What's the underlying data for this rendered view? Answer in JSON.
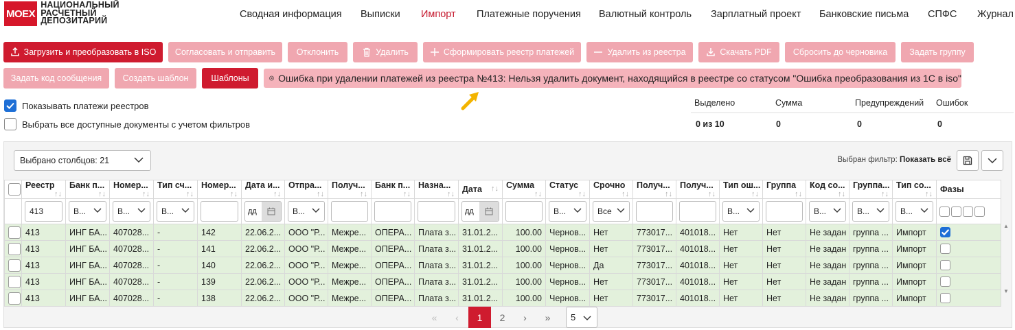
{
  "header": {
    "logo_mark": "MOEX",
    "logo_line1": "НАЦИОНАЛЬНЫЙ",
    "logo_line2": "РАСЧЕТНЫЙ",
    "logo_line3": "ДЕПОЗИТАРИЙ",
    "nav": [
      "Сводная информация",
      "Выписки",
      "Импорт",
      "Платежные поручения",
      "Валютный контроль",
      "Зарплатный проект",
      "Банковские письма",
      "СПФС",
      "Журнал"
    ],
    "active_nav": "Импорт"
  },
  "toolbar": {
    "upload": "Загрузить и преобразовать в ISO",
    "approve": "Согласовать и отправить",
    "reject": "Отклонить",
    "delete": "Удалить",
    "form_registry": "Сформировать реестр платежей",
    "remove_from_registry": "Удалить из реестра",
    "download_pdf": "Скачать PDF",
    "reset_draft": "Сбросить до черновика",
    "set_group": "Задать группу",
    "set_msg_code": "Задать код сообщения",
    "create_template": "Создать шаблон",
    "templates": "Шаблоны"
  },
  "error": "Ошибка при удалении платежей из реестра №413: Нельзя удалить документ, находящийся в реестре со статусом \"Ошибка преобразования из 1С в iso\"",
  "options": {
    "show_registry_payments": "Показывать платежи реестров",
    "select_all": "Выбрать все доступные документы с учетом фильтров"
  },
  "stats": {
    "selected_label": "Выделено",
    "selected": "0 из 10",
    "sum_label": "Сумма",
    "sum": "0",
    "warnings_label": "Предупреждений",
    "warnings": "0",
    "errors_label": "Ошибок",
    "errors": "0"
  },
  "table": {
    "columns_selected": "Выбрано столбцов: 21",
    "filter_label": "Выбран фильтр:",
    "filter_value": "Показать всё",
    "headers": [
      "Реестр",
      "Банк п...",
      "Номер...",
      "Тип сч...",
      "Номер...",
      "Дата и...",
      "Отпра...",
      "Получ...",
      "Банк п...",
      "Назна...",
      "Дата",
      "Сумма",
      "Статус",
      "Срочно",
      "Получ...",
      "Получ...",
      "Тип ош...",
      "Группа",
      "Код со...",
      "Группа...",
      "Тип со...",
      "Фазы"
    ],
    "filters": {
      "registry": "413",
      "select_short": "В...",
      "date_short": "дд",
      "urgent": "Все"
    },
    "rows": [
      [
        "413",
        "ИНГ БА...",
        "407028...",
        "-",
        "142",
        "22.06.2...",
        "ООО \"Р...",
        "Межре...",
        "ОПЕРА...",
        "Плата з...",
        "31.01.2...",
        "100.00",
        "Чернов...",
        "Нет",
        "773017...",
        "401018...",
        "Нет",
        "Нет",
        "Не задан",
        "группа ...",
        "Импорт"
      ],
      [
        "413",
        "ИНГ БА...",
        "407028...",
        "-",
        "141",
        "22.06.2...",
        "ООО \"Р...",
        "Межре...",
        "ОПЕРА...",
        "Плата з...",
        "31.01.2...",
        "100.00",
        "Чернов...",
        "Нет",
        "773017...",
        "401018...",
        "Нет",
        "Нет",
        "Не задан",
        "группа ...",
        "Импорт"
      ],
      [
        "413",
        "ИНГ БА...",
        "407028...",
        "-",
        "140",
        "22.06.2...",
        "ООО \"Р...",
        "Межре...",
        "ОПЕРА...",
        "Плата з...",
        "31.01.2...",
        "100.00",
        "Чернов...",
        "Да",
        "773017...",
        "401018...",
        "Нет",
        "Нет",
        "Не задан",
        "группа ...",
        "Импорт"
      ],
      [
        "413",
        "ИНГ БА...",
        "407028...",
        "-",
        "139",
        "22.06.2...",
        "ООО \"Р...",
        "Межре...",
        "ОПЕРА...",
        "Плата з...",
        "31.01.2...",
        "100.00",
        "Чернов...",
        "Нет",
        "773017...",
        "401018...",
        "Нет",
        "Нет",
        "Не задан",
        "группа ...",
        "Импорт"
      ],
      [
        "413",
        "ИНГ БА...",
        "407028...",
        "-",
        "138",
        "22.06.2...",
        "ООО \"Р...",
        "Межре...",
        "ОПЕРА...",
        "Плата з...",
        "31.01.2...",
        "100.00",
        "Чернов...",
        "Нет",
        "773017...",
        "401018...",
        "Нет",
        "Нет",
        "Не задан",
        "группа ...",
        "Импорт"
      ]
    ],
    "phase_checked": [
      true,
      false,
      false,
      false,
      false
    ]
  },
  "pagination": {
    "first": "«",
    "prev": "‹",
    "next": "›",
    "last": "»",
    "pages": [
      "1",
      "2"
    ],
    "current": "1",
    "page_size": "5"
  },
  "colors": {
    "accent": "#cf1b2f",
    "disabled": "#f0a7b0",
    "row_bg": "#e3f1dc",
    "error_bg": "#f5b3bb",
    "checkbox": "#1e6fd6"
  }
}
